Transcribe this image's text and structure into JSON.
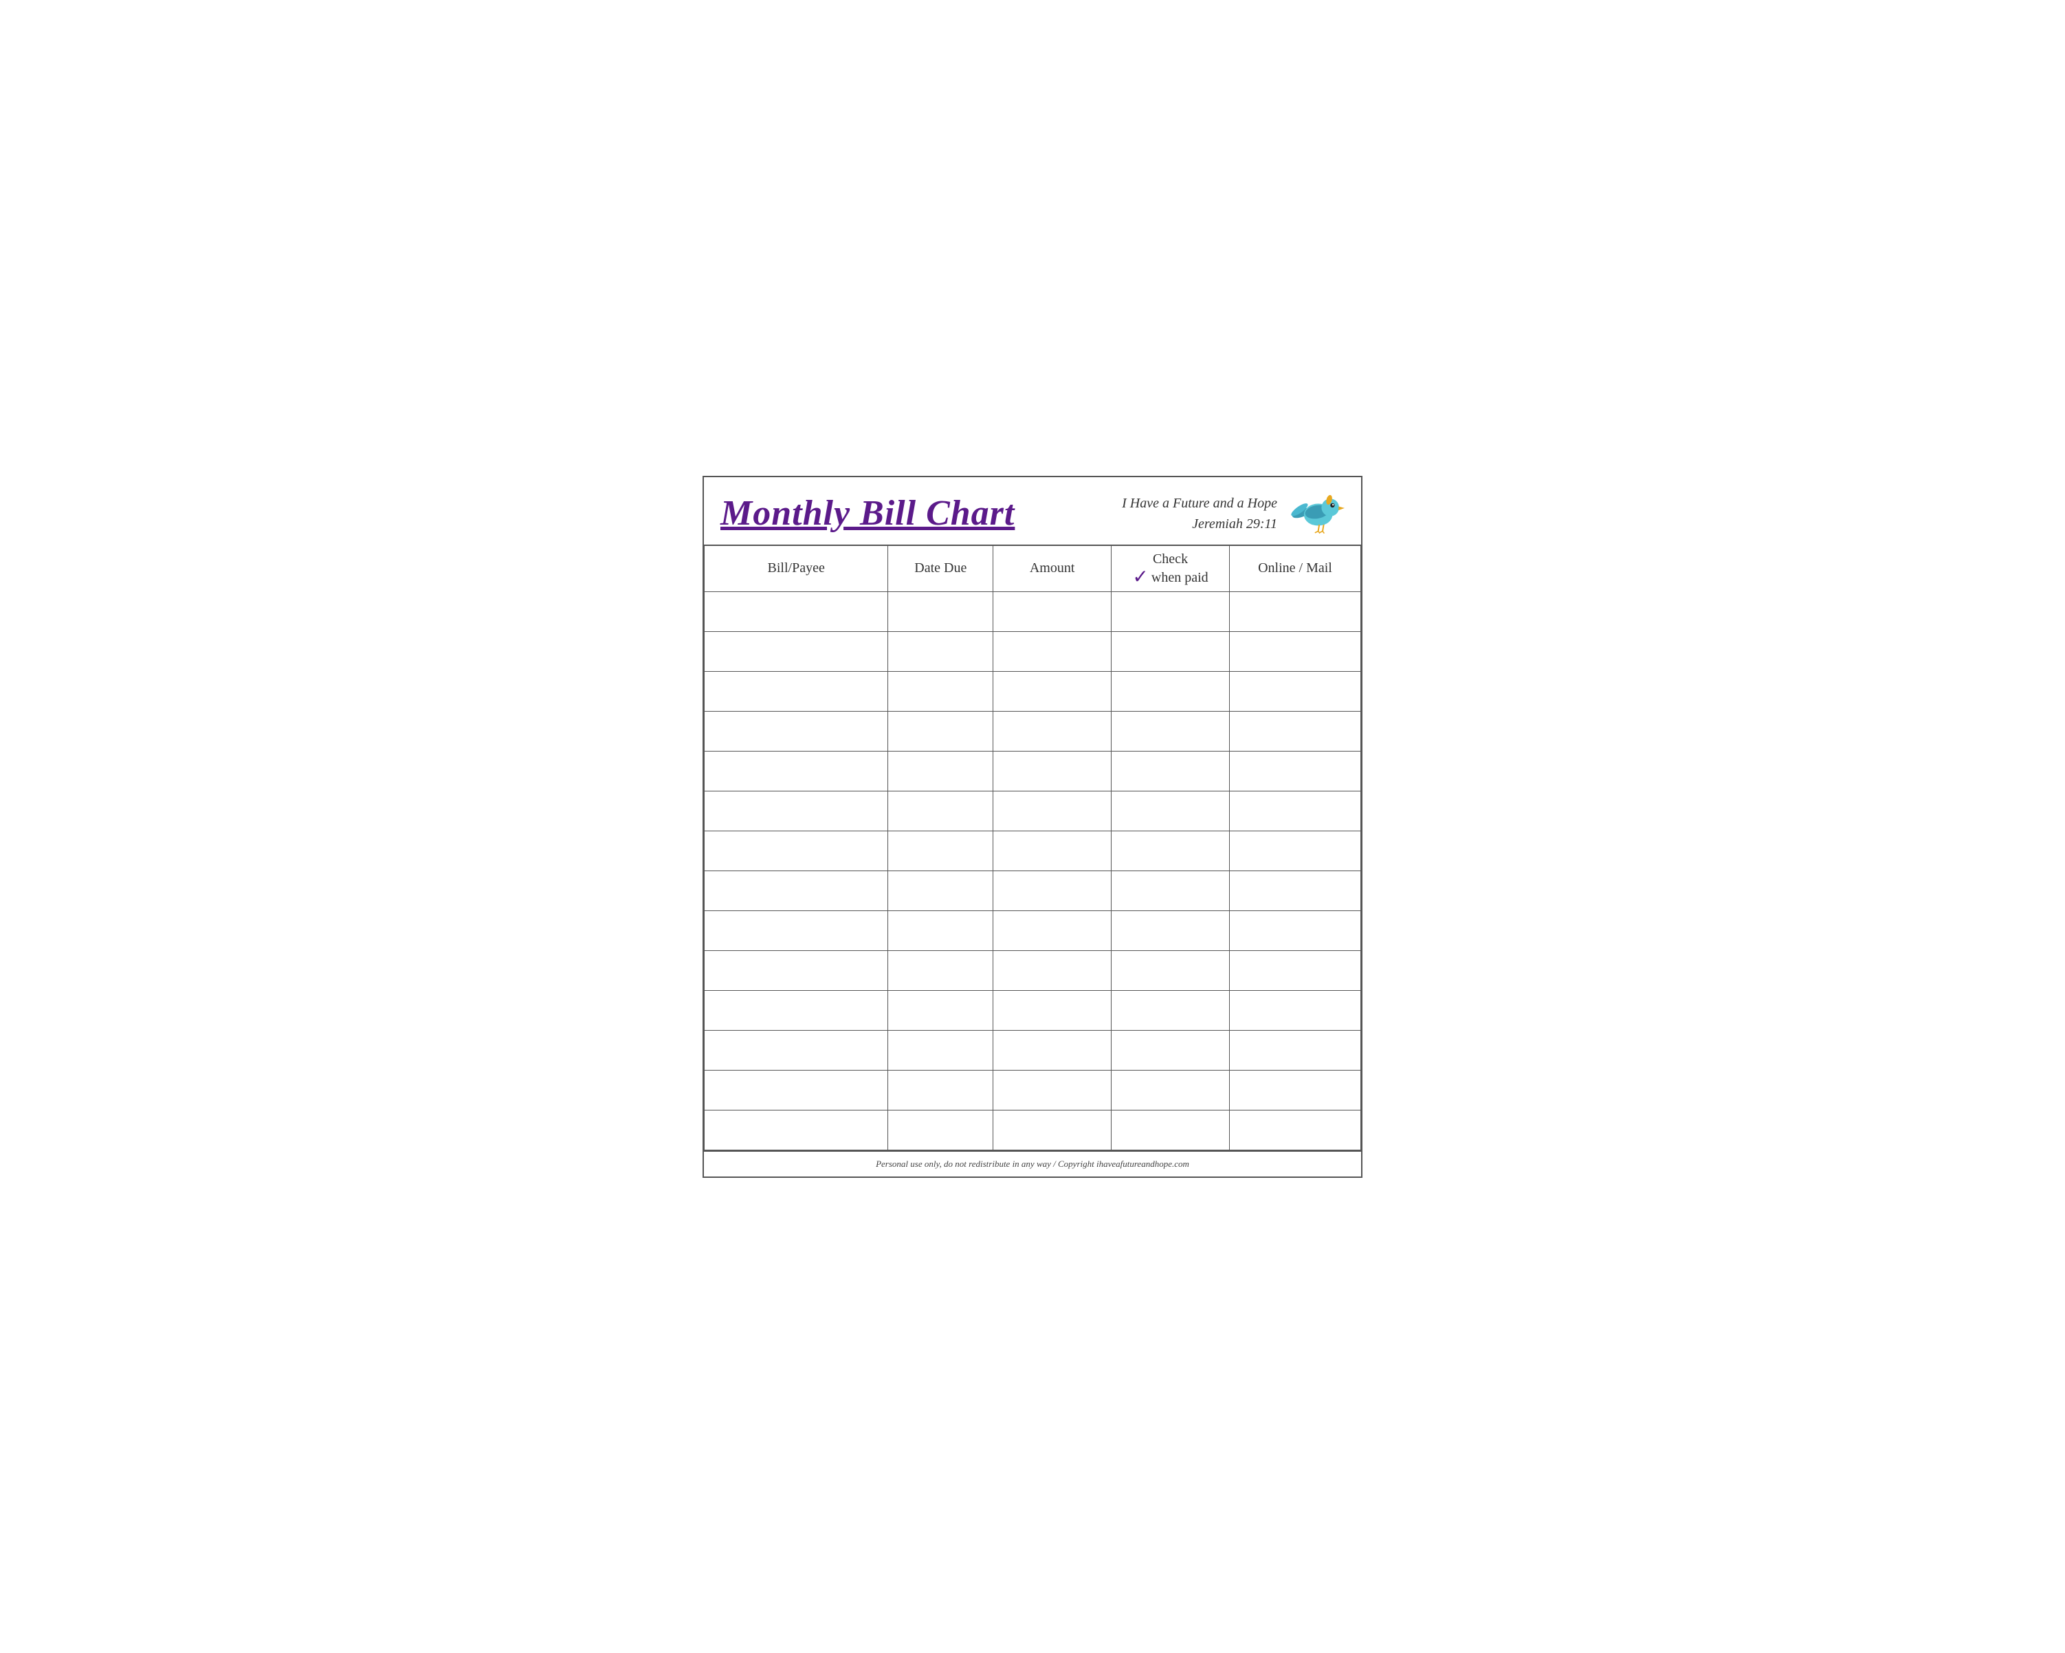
{
  "header": {
    "title": "Monthly Bill Chart",
    "tagline_line1": "I Have a Future and a Hope",
    "tagline_line2": "Jeremiah 29:11"
  },
  "table": {
    "columns": [
      {
        "key": "bill_payee",
        "label": "Bill/Payee"
      },
      {
        "key": "date_due",
        "label": "Date Due"
      },
      {
        "key": "amount",
        "label": "Amount"
      },
      {
        "key": "check_when_paid",
        "label_top": "Check",
        "label_bottom": "when paid",
        "has_checkmark": true
      },
      {
        "key": "online_mail",
        "label": "Online / Mail"
      }
    ],
    "row_count": 14
  },
  "footer": {
    "text": "Personal use only, do not redistribute in any way / Copyright ihaveafutureandhope.com"
  },
  "colors": {
    "title": "#5b1a8a",
    "checkmark": "#5b1a8a",
    "border": "#555555",
    "text": "#333333"
  }
}
